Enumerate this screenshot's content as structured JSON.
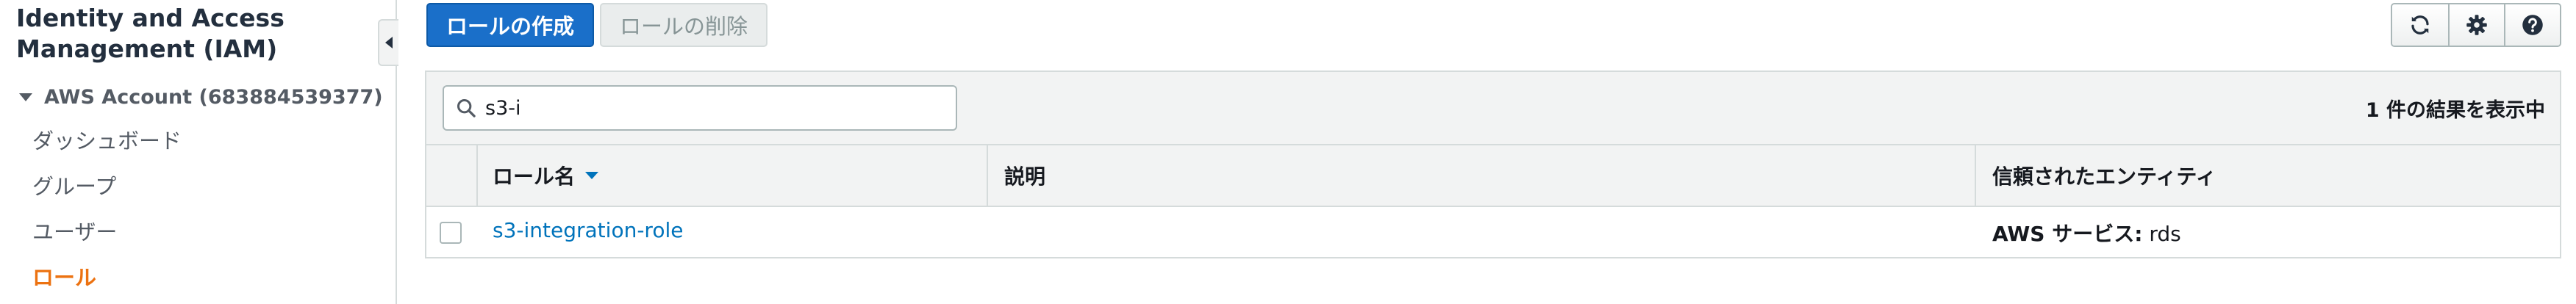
{
  "sidebar": {
    "title": "Identity and Access Management (IAM)",
    "account": "AWS Account (683884539377)",
    "items": [
      {
        "label": "ダッシュボード",
        "active": false
      },
      {
        "label": "グループ",
        "active": false
      },
      {
        "label": "ユーザー",
        "active": false
      },
      {
        "label": "ロール",
        "active": true
      }
    ]
  },
  "toolbar": {
    "create_role_label": "ロールの作成",
    "delete_role_label": "ロールの削除",
    "icons": [
      "refresh-icon",
      "gear-icon",
      "help-icon"
    ]
  },
  "search": {
    "value": "s3-i"
  },
  "results": {
    "count_text": "1 件の結果を表示中"
  },
  "table": {
    "columns": [
      "ロール名",
      "説明",
      "信頼されたエンティティ"
    ],
    "rows": [
      {
        "role_name": "s3-integration-role",
        "description": "",
        "entity_label": "AWS サービス:",
        "entity_value": "rds"
      }
    ]
  },
  "colors": {
    "primary_button": "#1a6fc9",
    "link": "#0073bb",
    "active_nav": "#ec7211",
    "panel_header": "#f2f3f3"
  }
}
